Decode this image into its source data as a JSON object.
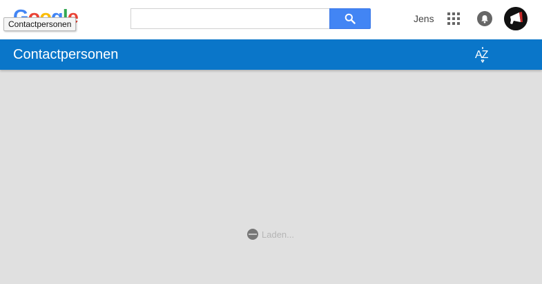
{
  "header": {
    "logo_letters": [
      "G",
      "o",
      "o",
      "g",
      "l",
      "e"
    ],
    "tooltip": "Contactpersonen",
    "search": {
      "value": "",
      "placeholder": "",
      "button_icon": "search-icon"
    },
    "user_name": "Jens",
    "apps_icon": "apps-grid-icon",
    "notifications_icon": "bell-icon",
    "avatar_icon": "avatar"
  },
  "appbar": {
    "title": "Contactpersonen",
    "sort_label": "AZ",
    "sort_icon": "sort-az-icon"
  },
  "main": {
    "loading_text": "Laden..."
  },
  "colors": {
    "appbar": "#0a76c9",
    "search_button": "#4285f4",
    "background": "#e0e0e0"
  }
}
